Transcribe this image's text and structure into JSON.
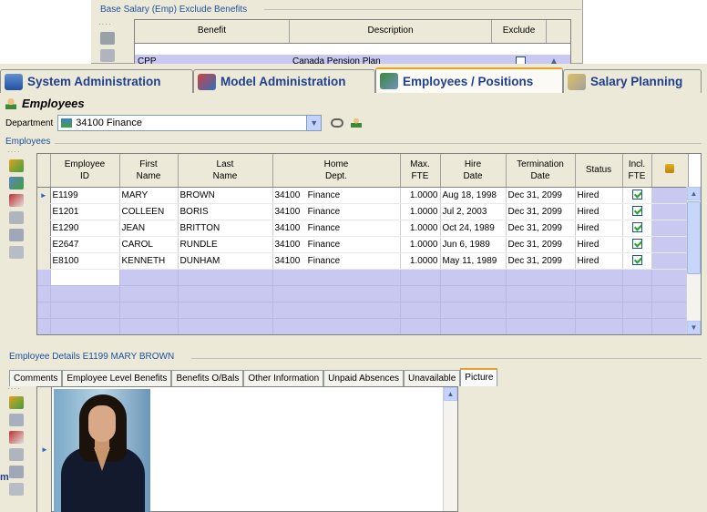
{
  "bg_dialog": {
    "legend": "Base Salary (Emp) Exclude Benefits",
    "columns": [
      "Benefit",
      "Description",
      "Exclude"
    ],
    "row": {
      "code": "CPP",
      "description": "Canada Pension Plan",
      "exclude": false
    }
  },
  "tabs": [
    {
      "label": "System Administration",
      "active": false,
      "icon": "computer-icon"
    },
    {
      "label": "Model Administration",
      "active": false,
      "icon": "model-icon"
    },
    {
      "label": "Employees / Positions",
      "active": true,
      "icon": "people-icon"
    },
    {
      "label": "Salary Planning",
      "active": false,
      "icon": "salary-icon"
    }
  ],
  "page": {
    "title": "Employees"
  },
  "department": {
    "label": "Department",
    "value": "34100  Finance"
  },
  "employees_section": {
    "label": "Employees"
  },
  "grid": {
    "columns": [
      {
        "label1": "Employee",
        "label2": "ID"
      },
      {
        "label1": "First",
        "label2": "Name"
      },
      {
        "label1": "Last",
        "label2": "Name"
      },
      {
        "label1": "Home",
        "label2": "Dept."
      },
      {
        "label1": "Max.",
        "label2": "FTE"
      },
      {
        "label1": "Hire",
        "label2": "Date"
      },
      {
        "label1": "Termination",
        "label2": "Date"
      },
      {
        "label1": "Status",
        "label2": ""
      },
      {
        "label1": "Incl.",
        "label2": "FTE"
      }
    ],
    "rows": [
      {
        "id": "E1199",
        "first": "MARY",
        "last": "BROWN",
        "dept_code": "34100",
        "dept_name": "Finance",
        "fte": "1.0000",
        "hire": "Aug 18, 1998",
        "term": "Dec 31, 2099",
        "status": "Hired",
        "incl": true
      },
      {
        "id": "E1201",
        "first": "COLLEEN",
        "last": "BORIS",
        "dept_code": "34100",
        "dept_name": "Finance",
        "fte": "1.0000",
        "hire": "Jul 2, 2003",
        "term": "Dec 31, 2099",
        "status": "Hired",
        "incl": true
      },
      {
        "id": "E1290",
        "first": "JEAN",
        "last": "BRITTON",
        "dept_code": "34100",
        "dept_name": "Finance",
        "fte": "1.0000",
        "hire": "Oct 24, 1989",
        "term": "Dec 31, 2099",
        "status": "Hired",
        "incl": true
      },
      {
        "id": "E2647",
        "first": "CAROL",
        "last": "RUNDLE",
        "dept_code": "34100",
        "dept_name": "Finance",
        "fte": "1.0000",
        "hire": "Jun 6, 1989",
        "term": "Dec 31, 2099",
        "status": "Hired",
        "incl": true
      },
      {
        "id": "E8100",
        "first": "KENNETH",
        "last": "DUNHAM",
        "dept_code": "34100",
        "dept_name": "Finance",
        "fte": "1.0000",
        "hire": "May 11, 1989",
        "term": "Dec 31, 2099",
        "status": "Hired",
        "incl": true
      }
    ]
  },
  "details": {
    "label": "Employee Details E1199 MARY BROWN",
    "tabs": [
      {
        "label": "Comments",
        "active": false
      },
      {
        "label": "Employee Level Benefits",
        "active": false
      },
      {
        "label": "Benefits O/Bals",
        "active": false
      },
      {
        "label": "Other Information",
        "active": false
      },
      {
        "label": "Unpaid Absences",
        "active": false
      },
      {
        "label": "Unavailable",
        "active": false
      },
      {
        "label": "Picture",
        "active": true
      }
    ]
  },
  "edge_text": "m",
  "colors": {
    "accent": "#f0a020",
    "tab_text": "#1f3f8f",
    "legend": "#2050a0",
    "row_fill": "#c8c8f0"
  }
}
